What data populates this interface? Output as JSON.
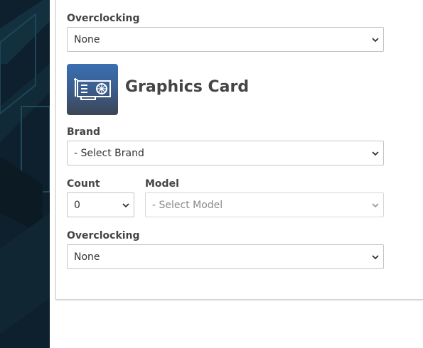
{
  "cpu_section": {
    "overclocking_label": "Overclocking",
    "overclocking_value": "None"
  },
  "gpu_section": {
    "title": "Graphics Card",
    "icon": "graphics-card-icon",
    "brand_label": "Brand",
    "brand_value": "- Select Brand",
    "count_label": "Count",
    "count_value": "0",
    "model_label": "Model",
    "model_value": "- Select Model",
    "overclocking_label": "Overclocking",
    "overclocking_value": "None"
  },
  "colors": {
    "icon_gradient_top": "#3a6fb3",
    "icon_gradient_bottom": "#3c4655",
    "sidebar_background": "#0f2230"
  }
}
